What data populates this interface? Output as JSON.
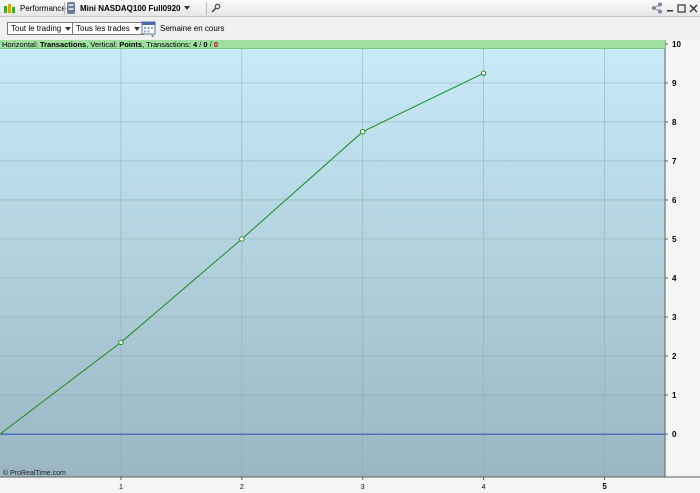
{
  "titlebar": {
    "performance_label": "Performance",
    "instrument_label": "Mini NASDAQ100 Full0920"
  },
  "toolbar": {
    "scope_select": "Tout le trading",
    "trades_select": "Tous les trades",
    "period_label": "Semaine en cours"
  },
  "info": {
    "horizontal_prefix": "Horizontal:",
    "horizontal_value": "Transactions",
    "vertical_prefix": ", Vertical:",
    "vertical_value": "Points",
    "transactions_prefix": ", Transactions:",
    "tx_total": "4",
    "tx_sep1": " / ",
    "tx_zero": "0",
    "tx_sep2": " / ",
    "tx_losing": "0"
  },
  "copyright": "© ProRealTime.com",
  "colors": {
    "line": "#1a8c1a",
    "zero_line": "#2a4db0",
    "bg_top": "#c9ecf9",
    "bg_bottom": "#9ab6c2",
    "grid": "#8aa8b4"
  },
  "chart_data": {
    "type": "line",
    "x": [
      0,
      1,
      2,
      3,
      4
    ],
    "series": [
      {
        "values": [
          0,
          2.35,
          5.0,
          7.75,
          9.25
        ]
      }
    ],
    "xlim": [
      0,
      5.5
    ],
    "ylim": [
      -1.1,
      10.1
    ],
    "x_ticks": [
      1,
      2,
      3,
      4,
      5
    ],
    "y_ticks": [
      0,
      1,
      2,
      3,
      4,
      5,
      6,
      7,
      8,
      9,
      10
    ],
    "grid": true
  }
}
